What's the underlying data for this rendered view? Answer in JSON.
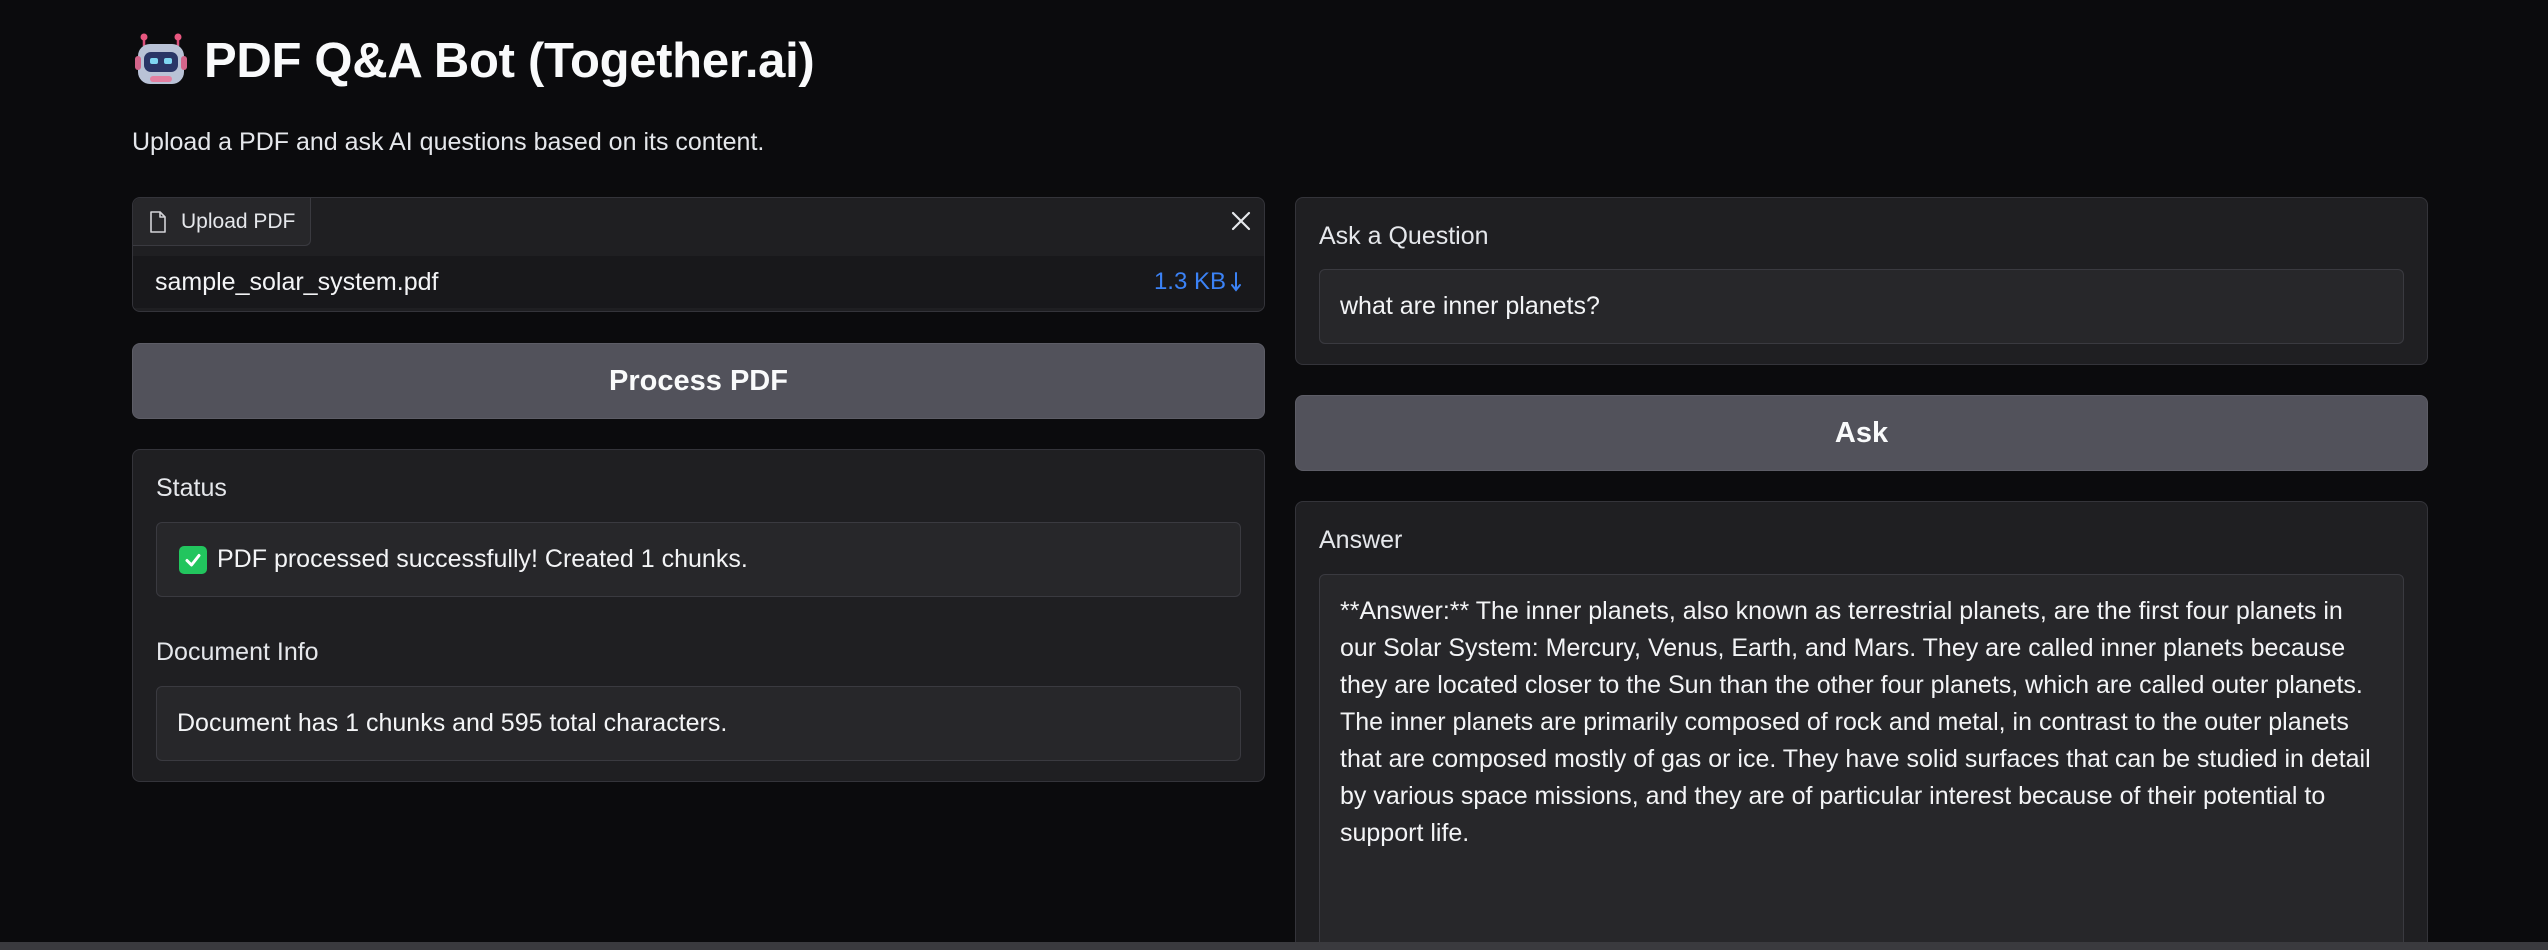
{
  "header": {
    "icon": "robot-icon",
    "title": "PDF Q&A Bot (Together.ai)",
    "subtitle": "Upload a PDF and ask AI questions based on its content."
  },
  "upload": {
    "tab_label": "Upload PDF",
    "tab_icon": "file-icon",
    "file_name": "sample_solar_system.pdf",
    "file_size": "1.3 KB",
    "download_icon": "download-arrow-icon",
    "close_icon": "close-icon"
  },
  "process_button": {
    "label": "Process PDF"
  },
  "status": {
    "label": "Status",
    "icon": "check-icon",
    "value": "PDF processed successfully! Created 1 chunks."
  },
  "document_info": {
    "label": "Document Info",
    "value": "Document has 1 chunks and 595 total characters."
  },
  "question": {
    "label": "Ask a Question",
    "value": "what are inner planets?"
  },
  "ask_button": {
    "label": "Ask"
  },
  "answer": {
    "label": "Answer",
    "value": "**Answer:** The inner planets, also known as terrestrial planets, are the first four planets in our Solar System: Mercury, Venus, Earth, and Mars. They are called inner planets because they are located closer to the Sun than the other four planets, which are called outer planets. The inner planets are primarily composed of rock and metal, in contrast to the outer planets that are composed mostly of gas or ice. They have solid surfaces that can be studied in detail by various space missions, and they are of particular interest because of their potential to support life."
  },
  "colors": {
    "background": "#0b0b0d",
    "panel": "#1f1f22",
    "button": "#52525b",
    "link_blue": "#3b82f6",
    "success_green": "#22c55e"
  }
}
